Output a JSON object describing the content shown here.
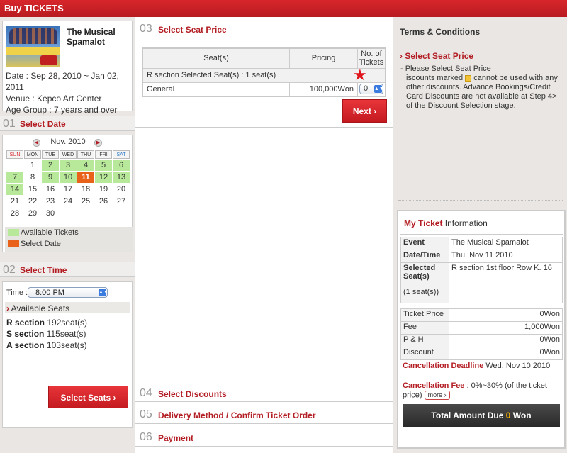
{
  "header": {
    "title": "Buy TICKETS"
  },
  "event": {
    "title": "The Musical Spamalot",
    "date": "Date : Sep 28, 2010 ~ Jan 02, 2011",
    "venue": "Venue : Kepco Art Center",
    "age": "Age Group : 7 years and over"
  },
  "steps": {
    "s1": {
      "num": "01",
      "label": "Select Date"
    },
    "s2": {
      "num": "02",
      "label": "Select Time"
    },
    "s3": {
      "num": "03",
      "label": "Select Seat Price"
    },
    "s4": {
      "num": "04",
      "label": "Select Discounts"
    },
    "s5": {
      "num": "05",
      "label": "Delivery Method / Confirm Ticket Order"
    },
    "s6": {
      "num": "06",
      "label": "Payment"
    }
  },
  "calendar": {
    "month": "Nov. 2010",
    "prev_icon": "◀",
    "next_icon": "▶",
    "weekdays": [
      "SUN",
      "MON",
      "TUE",
      "WED",
      "THU",
      "FRI",
      "SAT"
    ],
    "weeks": [
      [
        {
          "d": "",
          "s": ""
        },
        {
          "d": "1",
          "s": ""
        },
        {
          "d": "2",
          "s": "av"
        },
        {
          "d": "3",
          "s": "av"
        },
        {
          "d": "4",
          "s": "av"
        },
        {
          "d": "5",
          "s": "av"
        },
        {
          "d": "6",
          "s": "av"
        }
      ],
      [
        {
          "d": "7",
          "s": "av"
        },
        {
          "d": "8",
          "s": ""
        },
        {
          "d": "9",
          "s": "av"
        },
        {
          "d": "10",
          "s": "av"
        },
        {
          "d": "11",
          "s": "sel"
        },
        {
          "d": "12",
          "s": "av"
        },
        {
          "d": "13",
          "s": "av"
        }
      ],
      [
        {
          "d": "14",
          "s": "av"
        },
        {
          "d": "15",
          "s": ""
        },
        {
          "d": "16",
          "s": ""
        },
        {
          "d": "17",
          "s": ""
        },
        {
          "d": "18",
          "s": ""
        },
        {
          "d": "19",
          "s": ""
        },
        {
          "d": "20",
          "s": ""
        }
      ],
      [
        {
          "d": "21",
          "s": ""
        },
        {
          "d": "22",
          "s": ""
        },
        {
          "d": "23",
          "s": ""
        },
        {
          "d": "24",
          "s": ""
        },
        {
          "d": "25",
          "s": ""
        },
        {
          "d": "26",
          "s": ""
        },
        {
          "d": "27",
          "s": ""
        }
      ],
      [
        {
          "d": "28",
          "s": ""
        },
        {
          "d": "29",
          "s": ""
        },
        {
          "d": "30",
          "s": ""
        },
        {
          "d": "",
          "s": ""
        },
        {
          "d": "",
          "s": ""
        },
        {
          "d": "",
          "s": ""
        },
        {
          "d": "",
          "s": ""
        }
      ]
    ],
    "legend_available": "Available Tickets",
    "legend_selected": "Select Date"
  },
  "colors": {
    "available": "#b8e89a",
    "selected": "#e8621a",
    "brand_red": "#b31e24"
  },
  "time": {
    "label": "Time :",
    "value": "8:00 PM",
    "available_header": "Available Seats",
    "sections": [
      {
        "name": "R section",
        "count": "192seat(s)"
      },
      {
        "name": "S section",
        "count": "115seat(s)"
      },
      {
        "name": "A section",
        "count": "103seat(s)"
      }
    ],
    "button": "Select Seats"
  },
  "price_table": {
    "headers": [
      "Seat(s)",
      "Pricing",
      "No. of Tickets"
    ],
    "section_row": "R section Selected Seat(s) : 1 seat(s)",
    "rows": [
      {
        "type": "General",
        "price": "100,000Won",
        "qty": "0"
      }
    ],
    "next_button": "Next"
  },
  "terms": {
    "title": "Terms & Conditions",
    "subtitle": "Select Seat Price",
    "line1": "- Please Select Seat Price",
    "line2a": "iscounts marked",
    "line2b": "cannot be used with any other discounts. Advance Bookings/Credit Card Discounts are not available at Step 4> of the Discount Selection stage."
  },
  "my_ticket": {
    "title_red": "My Ticket",
    "title_rest": " Information",
    "event_k": "Event",
    "event_v": "The Musical Spamalot",
    "date_k": "Date/Time",
    "date_v": "Thu. Nov 11 2010",
    "seat_k": "Selected Seat(s)",
    "seat_v": "R section 1st floor Row K. 16",
    "seat_count": "(1 seat(s))",
    "fees": [
      {
        "k": "Ticket Price",
        "v": "0Won"
      },
      {
        "k": "Fee",
        "v": "1,000Won"
      },
      {
        "k": "P & H",
        "v": "0Won"
      },
      {
        "k": "Discount",
        "v": "0Won"
      }
    ],
    "cxl_deadline_k": "Cancellation Deadline",
    "cxl_deadline_v": " Wed. Nov 10 2010",
    "cxl_fee_k": "Cancellation Fee",
    "cxl_fee_v": " : 0%~30% (of the ticket price)",
    "more": "more",
    "total_label": "Total Amount Due",
    "total_amount": "0",
    "total_unit": "Won"
  }
}
